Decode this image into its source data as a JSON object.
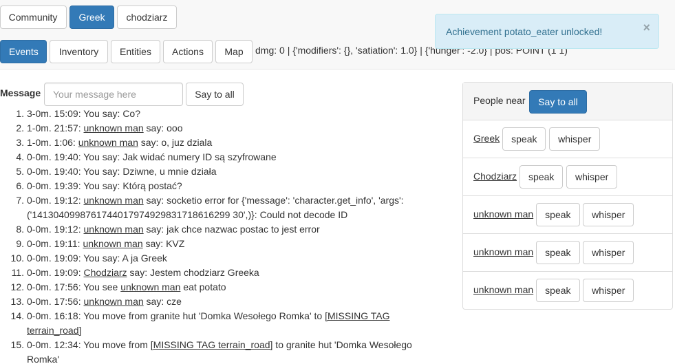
{
  "top_buttons": {
    "community": "Community",
    "greek": "Greek",
    "chodziarz": "chodziarz"
  },
  "tabs": {
    "events": "Events",
    "inventory": "Inventory",
    "entities": "Entities",
    "actions": "Actions",
    "map": "Map"
  },
  "status_line": "dmg: 0 | {'modifiers': {}, 'satiation': 1.0} | {'hunger': -2.0} | pos: POINT (1 1)",
  "alert": {
    "text": "Achievement potato_eater unlocked!",
    "close": "×"
  },
  "message": {
    "label": "Message",
    "placeholder": "Your message here",
    "say_all": "Say to all"
  },
  "events": [
    [
      {
        "t": "3-0m. 15:09: You say: Co?"
      }
    ],
    [
      {
        "t": "1-0m. 21:57: "
      },
      {
        "t": "unknown man",
        "u": true
      },
      {
        "t": " say: ooo"
      }
    ],
    [
      {
        "t": "1-0m. 1:06: "
      },
      {
        "t": "unknown man",
        "u": true
      },
      {
        "t": " say: o, juz dziala"
      }
    ],
    [
      {
        "t": "0-0m. 19:40: You say: Jak widać numery ID są szyfrowane"
      }
    ],
    [
      {
        "t": "0-0m. 19:40: You say: Dziwne, u mnie działa"
      }
    ],
    [
      {
        "t": "0-0m. 19:39: You say: Którą postać?"
      }
    ],
    [
      {
        "t": "0-0m. 19:12: "
      },
      {
        "t": "unknown man",
        "u": true
      },
      {
        "t": " say: socketio error for {'message': 'character.get_info', 'args':"
      },
      {
        "br": true
      },
      {
        "t": "('1413040998761744017974929831718616299 30',)}: Could not decode ID"
      }
    ],
    [
      {
        "t": "0-0m. 19:12: "
      },
      {
        "t": "unknown man",
        "u": true
      },
      {
        "t": " say: jak chce nazwac postac to jest error"
      }
    ],
    [
      {
        "t": "0-0m. 19:11: "
      },
      {
        "t": "unknown man",
        "u": true
      },
      {
        "t": " say: KVZ"
      }
    ],
    [
      {
        "t": "0-0m. 19:09: You say: A ja Greek"
      }
    ],
    [
      {
        "t": "0-0m. 19:09: "
      },
      {
        "t": "Chodziarz",
        "u": true
      },
      {
        "t": " say: Jestem chodziarz Greeka"
      }
    ],
    [
      {
        "t": "0-0m. 17:56: You see "
      },
      {
        "t": "unknown man",
        "u": true
      },
      {
        "t": " eat potato"
      }
    ],
    [
      {
        "t": "0-0m. 17:56: "
      },
      {
        "t": "unknown man",
        "u": true
      },
      {
        "t": " say: cze"
      }
    ],
    [
      {
        "t": "0-0m. 16:18: You move from granite hut 'Domka Wesołego Romka' to "
      },
      {
        "t": "[MISSING TAG",
        "u": true
      },
      {
        "br": true
      },
      {
        "t": "terrain_road]",
        "u": true
      }
    ],
    [
      {
        "t": "0-0m. 12:34: You move from "
      },
      {
        "t": "[MISSING TAG terrain_road]",
        "u": true
      },
      {
        "t": " to granite hut 'Domka Wesołego"
      },
      {
        "br": true
      },
      {
        "t": "Romka'"
      }
    ]
  ],
  "people": {
    "heading": "People near",
    "say_all": "Say to all",
    "speak_label": "speak",
    "whisper_label": "whisper",
    "list": [
      "Greek",
      "Chodziarz",
      "unknown man",
      "unknown man",
      "unknown man"
    ]
  }
}
